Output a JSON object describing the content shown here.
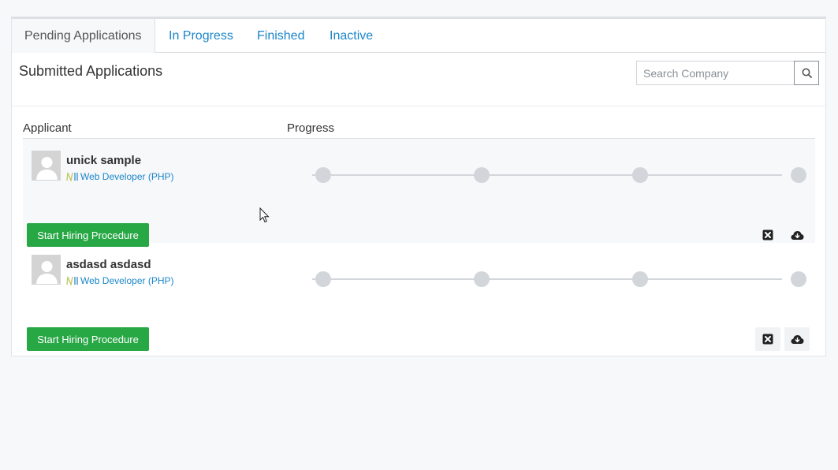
{
  "tabs": [
    {
      "label": "Pending Applications",
      "active": true
    },
    {
      "label": "In Progress",
      "active": false
    },
    {
      "label": "Finished",
      "active": false
    },
    {
      "label": "Inactive",
      "active": false
    }
  ],
  "section": {
    "title": "Submitted Applications"
  },
  "search": {
    "placeholder": "Search Company",
    "value": "",
    "icon": "search-icon"
  },
  "table": {
    "headers": {
      "applicant": "Applicant",
      "progress": "Progress"
    }
  },
  "applications": [
    {
      "name": "unick sample",
      "job": "Web Developer (PHP)",
      "progress_steps": 4,
      "completed_steps": 0,
      "action_label": "Start Hiring Procedure"
    },
    {
      "name": "asdasd asdasd",
      "job": "Web Developer (PHP)",
      "progress_steps": 4,
      "completed_steps": 0,
      "action_label": "Start Hiring Procedure"
    }
  ],
  "colors": {
    "accent_link": "#1b86c9",
    "success_button": "#28a745",
    "progress_dot": "#d2d6db"
  }
}
